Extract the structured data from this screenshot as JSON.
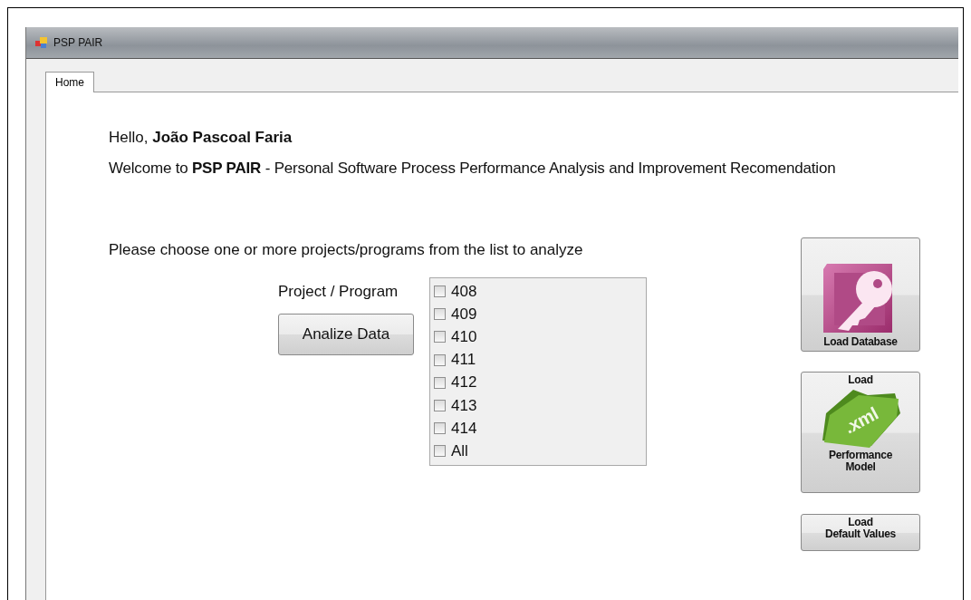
{
  "window": {
    "title": "PSP PAIR"
  },
  "tabs": [
    {
      "label": "Home",
      "selected": true
    }
  ],
  "greeting": "Hello, **João Pascoal Faria**",
  "welcome": "Welcome to **PSP PAIR** - Personal Software Process Performance Analysis and Improvement Recomendation",
  "instruction": "Please choose one or more projects/programs from the list to analyze",
  "project_label": "Project / Program",
  "analyze_button": "Analize Data",
  "projects": [
    {
      "label": "408",
      "checked": false
    },
    {
      "label": "409",
      "checked": false
    },
    {
      "label": "410",
      "checked": false
    },
    {
      "label": "411",
      "checked": false
    },
    {
      "label": "412",
      "checked": false
    },
    {
      "label": "413",
      "checked": false
    },
    {
      "label": "414",
      "checked": false
    },
    {
      "label": "All",
      "checked": false
    }
  ],
  "side_buttons": [
    {
      "kind": "database",
      "label_bottom": "Load Database"
    },
    {
      "kind": "xml",
      "label_top": "Load",
      "icon_text": ".xml",
      "label_bottom": "Performance\nModel"
    },
    {
      "kind": "text",
      "label_bottom": "Load\nDefault Values"
    }
  ]
}
